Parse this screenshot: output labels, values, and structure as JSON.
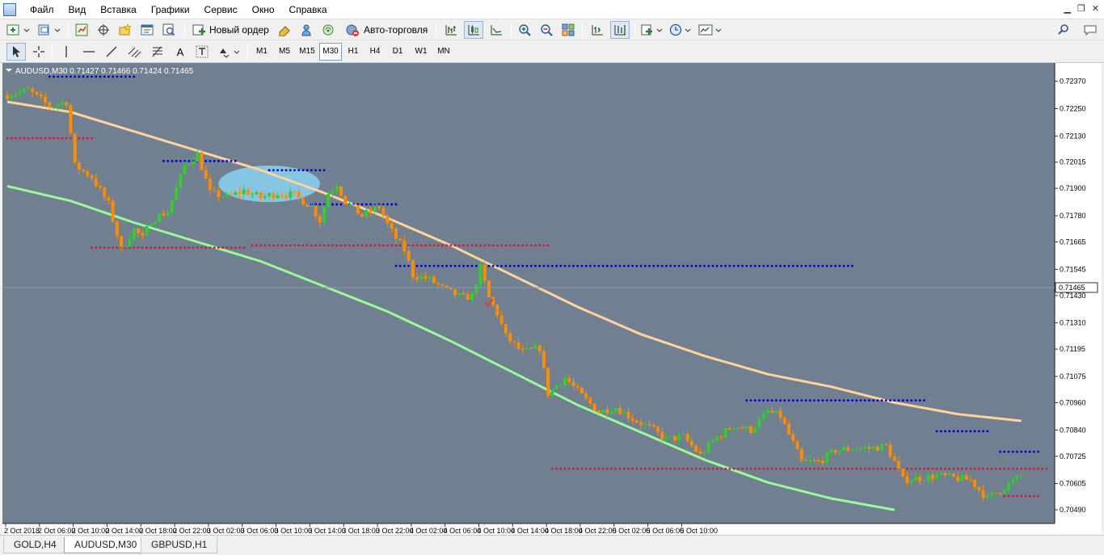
{
  "menu": [
    "Файл",
    "Вид",
    "Вставка",
    "Графики",
    "Сервис",
    "Окно",
    "Справка"
  ],
  "toolbar": {
    "new_order": "Новый ордер",
    "auto_trading": "Авто-торговля"
  },
  "drawtools": {
    "text_tool": "A"
  },
  "timeframes": [
    "M1",
    "M5",
    "M15",
    "M30",
    "H1",
    "H4",
    "D1",
    "W1",
    "MN"
  ],
  "active_timeframe": "M30",
  "chart": {
    "info": "AUDUSD,M30  0.71427 0.71466 0.71424 0.71465",
    "current_price": "0.71465",
    "background": "#708090",
    "bull_color": "#32cd32",
    "bear_color": "#ff8c00"
  },
  "tabs": [
    "GOLD,H4",
    "AUDUSD,M30",
    "GBPUSD,H1"
  ],
  "active_tab": "AUDUSD,M30",
  "chart_data": {
    "type": "candlestick",
    "symbol": "AUDUSD",
    "timeframe": "M30",
    "ylim": [
      0.7043,
      0.7245
    ],
    "y_ticks": [
      "0.72370",
      "0.72250",
      "0.72130",
      "0.72015",
      "0.71900",
      "0.71780",
      "0.71665",
      "0.71545",
      "0.71430",
      "0.71310",
      "0.71195",
      "0.71075",
      "0.70960",
      "0.70840",
      "0.70725",
      "0.70605",
      "0.70490"
    ],
    "x_ticks": [
      "2 Oct 2018",
      "2 Oct 06:00",
      "2 Oct 10:00",
      "2 Oct 14:00",
      "2 Oct 18:00",
      "2 Oct 22:00",
      "3 Oct 02:00",
      "3 Oct 06:00",
      "3 Oct 10:00",
      "3 Oct 14:00",
      "3 Oct 18:00",
      "3 Oct 22:00",
      "4 Oct 02:00",
      "4 Oct 06:00",
      "4 Oct 10:00",
      "4 Oct 14:00",
      "4 Oct 18:00",
      "4 Oct 22:00",
      "5 Oct 02:00",
      "5 Oct 06:00",
      "5 Oct 10:00"
    ],
    "close_path": [
      [
        0,
        0.7231
      ],
      [
        5,
        0.7233
      ],
      [
        10,
        0.7226
      ],
      [
        14,
        0.7228
      ],
      [
        16,
        0.72
      ],
      [
        20,
        0.7195
      ],
      [
        24,
        0.7183
      ],
      [
        27,
        0.7163
      ],
      [
        30,
        0.7172
      ],
      [
        32,
        0.7168
      ],
      [
        34,
        0.7176
      ],
      [
        38,
        0.718
      ],
      [
        42,
        0.72
      ],
      [
        45,
        0.7205
      ],
      [
        48,
        0.7188
      ],
      [
        52,
        0.7186
      ],
      [
        56,
        0.7189
      ],
      [
        60,
        0.7186
      ],
      [
        64,
        0.7188
      ],
      [
        68,
        0.7187
      ],
      [
        72,
        0.7182
      ],
      [
        74,
        0.7176
      ],
      [
        76,
        0.7188
      ],
      [
        78,
        0.7192
      ],
      [
        80,
        0.7184
      ],
      [
        84,
        0.7178
      ],
      [
        88,
        0.7182
      ],
      [
        90,
        0.7174
      ],
      [
        92,
        0.7168
      ],
      [
        94,
        0.7163
      ],
      [
        96,
        0.7152
      ],
      [
        100,
        0.715
      ],
      [
        104,
        0.7145
      ],
      [
        108,
        0.7142
      ],
      [
        110,
        0.7143
      ],
      [
        112,
        0.7155
      ],
      [
        114,
        0.7142
      ],
      [
        116,
        0.7135
      ],
      [
        118,
        0.7125
      ],
      [
        122,
        0.7118
      ],
      [
        126,
        0.712
      ],
      [
        128,
        0.71
      ],
      [
        132,
        0.7107
      ],
      [
        136,
        0.7099
      ],
      [
        140,
        0.7092
      ],
      [
        144,
        0.7094
      ],
      [
        148,
        0.7089
      ],
      [
        152,
        0.7085
      ],
      [
        156,
        0.708
      ],
      [
        160,
        0.7081
      ],
      [
        164,
        0.7073
      ],
      [
        168,
        0.7081
      ],
      [
        172,
        0.7086
      ],
      [
        176,
        0.7084
      ],
      [
        180,
        0.7092
      ],
      [
        183,
        0.709
      ],
      [
        186,
        0.7078
      ],
      [
        188,
        0.707
      ],
      [
        192,
        0.707
      ],
      [
        196,
        0.7075
      ],
      [
        200,
        0.7076
      ],
      [
        204,
        0.7076
      ],
      [
        208,
        0.7077
      ],
      [
        210,
        0.707
      ],
      [
        212,
        0.7062
      ],
      [
        216,
        0.7063
      ],
      [
        220,
        0.7064
      ],
      [
        224,
        0.7063
      ],
      [
        228,
        0.7062
      ],
      [
        230,
        0.7058
      ],
      [
        232,
        0.7054
      ],
      [
        236,
        0.7059
      ],
      [
        240,
        0.7064
      ]
    ],
    "ma_slow": [
      [
        0,
        0.7228
      ],
      [
        15,
        0.72235
      ],
      [
        30,
        0.7215
      ],
      [
        45,
        0.72065
      ],
      [
        60,
        0.7198
      ],
      [
        75,
        0.7188
      ],
      [
        90,
        0.7177
      ],
      [
        105,
        0.7165
      ],
      [
        120,
        0.71515
      ],
      [
        135,
        0.7138
      ],
      [
        150,
        0.7126
      ],
      [
        165,
        0.71165
      ],
      [
        180,
        0.71085
      ],
      [
        195,
        0.7103
      ],
      [
        210,
        0.7096
      ],
      [
        225,
        0.7091
      ],
      [
        240,
        0.7088
      ]
    ],
    "ma_fast": [
      [
        0,
        0.7191
      ],
      [
        15,
        0.71845
      ],
      [
        30,
        0.7175
      ],
      [
        45,
        0.71665
      ],
      [
        60,
        0.7158
      ],
      [
        75,
        0.7147
      ],
      [
        90,
        0.7136
      ],
      [
        105,
        0.7123
      ],
      [
        120,
        0.7109
      ],
      [
        135,
        0.7095
      ],
      [
        150,
        0.7083
      ],
      [
        165,
        0.7071
      ],
      [
        180,
        0.7061
      ],
      [
        195,
        0.7054
      ],
      [
        210,
        0.7049
      ]
    ],
    "resistance_levels": [
      [
        10,
        30,
        0.7239
      ],
      [
        37,
        54,
        0.7202
      ],
      [
        62,
        75,
        0.7198
      ],
      [
        72,
        92,
        0.7183
      ],
      [
        92,
        200,
        0.7156
      ],
      [
        175,
        217,
        0.7097
      ],
      [
        220,
        232,
        0.70835
      ],
      [
        235,
        244,
        0.70745
      ]
    ],
    "support_levels": [
      [
        0,
        20,
        0.7212
      ],
      [
        20,
        56,
        0.7164
      ],
      [
        58,
        128,
        0.7165
      ],
      [
        129,
        246,
        0.7067
      ],
      [
        236,
        244,
        0.7055
      ]
    ],
    "highlight": {
      "center_x": 62,
      "center_y": 0.7192,
      "rx": 12,
      "ry": 0.0008
    }
  }
}
